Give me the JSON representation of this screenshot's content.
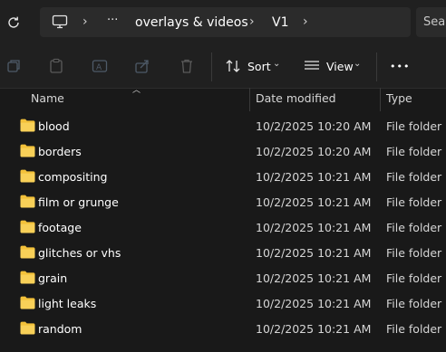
{
  "address": {
    "segments": [
      "overlays & videos",
      "V1"
    ],
    "more": "···",
    "search_placeholder": "Sea"
  },
  "toolbar": {
    "sort_label": "Sort",
    "view_label": "View",
    "more_label": "•••"
  },
  "columns": {
    "name": "Name",
    "date_modified": "Date modified",
    "type": "Type"
  },
  "rows": [
    {
      "name": "blood",
      "date": "10/2/2025 10:20 AM",
      "type": "File folder"
    },
    {
      "name": "borders",
      "date": "10/2/2025 10:20 AM",
      "type": "File folder"
    },
    {
      "name": "compositing",
      "date": "10/2/2025 10:21 AM",
      "type": "File folder"
    },
    {
      "name": "film or grunge",
      "date": "10/2/2025 10:21 AM",
      "type": "File folder"
    },
    {
      "name": "footage",
      "date": "10/2/2025 10:21 AM",
      "type": "File folder"
    },
    {
      "name": "glitches or vhs",
      "date": "10/2/2025 10:21 AM",
      "type": "File folder"
    },
    {
      "name": "grain",
      "date": "10/2/2025 10:21 AM",
      "type": "File folder"
    },
    {
      "name": "light leaks",
      "date": "10/2/2025 10:21 AM",
      "type": "File folder"
    },
    {
      "name": "random",
      "date": "10/2/2025 10:21 AM",
      "type": "File folder"
    }
  ],
  "colors": {
    "folder": "#f3c13a",
    "background": "#191919"
  }
}
